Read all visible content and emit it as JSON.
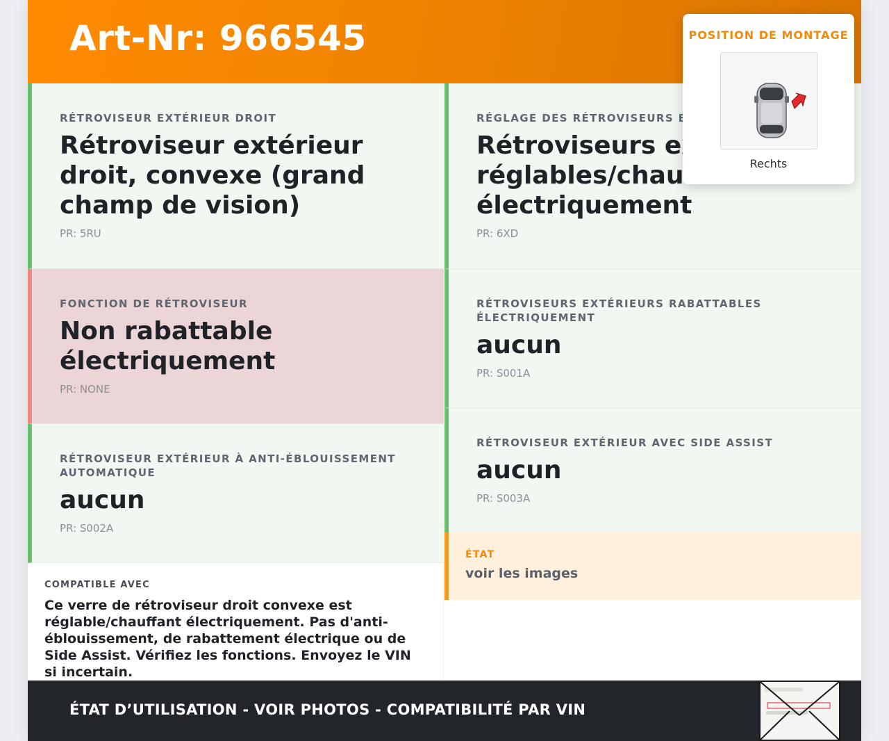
{
  "header": {
    "title": "Art-Nr: 966545"
  },
  "cards_left": [
    {
      "kicker": "RÉTROVISEUR EXTÉRIEUR DROIT",
      "value": "Rétroviseur extérieur droit, convexe (grand champ de vision)",
      "pr": "PR: 5RU",
      "status": "ok"
    },
    {
      "kicker": "FONCTION DE RÉTROVISEUR",
      "value": "Non rabattable électriquement",
      "pr": "PR: NONE",
      "status": "bad"
    },
    {
      "kicker": "RÉTROVISEUR EXTÉRIEUR À ANTI-ÉBLOUISSEMENT AUTOMATIQUE",
      "value": "aucun",
      "pr": "PR: S002A",
      "status": "ok"
    }
  ],
  "cards_right": [
    {
      "kicker": "RÉGLAGE DES RÉTROVISEURS EXT",
      "value": "Rétroviseurs exté réglables/chauffa électriquement",
      "pr": "PR: 6XD",
      "status": "ok"
    },
    {
      "kicker": "RÉTROVISEURS EXTÉRIEURS RABATTABLES ÉLECTRIQUEMENT",
      "value": "aucun",
      "pr": "PR: S001A",
      "status": "ok"
    },
    {
      "kicker": "RÉTROVISEUR EXTÉRIEUR AVEC SIDE ASSIST",
      "value": "aucun",
      "pr": "PR: S003A",
      "status": "ok"
    }
  ],
  "compat": {
    "kicker": "COMPATIBLE AVEC",
    "text": "Ce verre de rétroviseur droit convexe est réglable/chauffant électriquement. Pas d'anti-éblouissement, de rabattement électrique ou de Side Assist. Vérifiez les fonctions. Envoyez le VIN si incertain."
  },
  "etat": {
    "kicker": "ÉTAT",
    "text": "voir les images"
  },
  "footer": {
    "text": "ÉTAT D’UTILISATION - VOIR PHOTOS - COMPATIBILITÉ PAR VIN"
  },
  "mount": {
    "title": "POSITION DE MONTAGE",
    "label": "Rechts",
    "icon": "car-top-view-icon"
  },
  "colors": {
    "accent": "#ff8a00",
    "ok": "#6bc06f",
    "bad": "#f08585",
    "warn": "#f79a1c",
    "footer": "#22252a"
  }
}
